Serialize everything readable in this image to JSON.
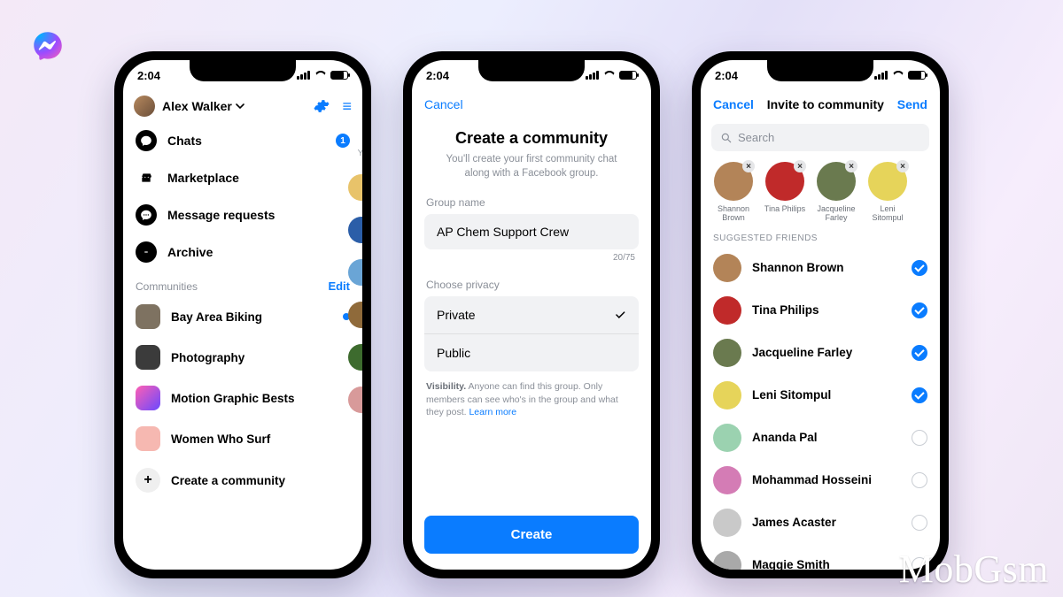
{
  "logo": {
    "color_start": "#FF6ABF",
    "color_mid": "#9C4BFF",
    "color_end": "#00AEFF"
  },
  "status": {
    "time": "2:04"
  },
  "phone1": {
    "user_name": "Alex Walker",
    "nav": [
      {
        "icon": "chat",
        "label": "Chats",
        "badge": "1"
      },
      {
        "icon": "store",
        "label": "Marketplace"
      },
      {
        "icon": "dots",
        "label": "Message requests"
      },
      {
        "icon": "archive",
        "label": "Archive"
      }
    ],
    "right_hint": "Yo",
    "communities_label": "Communities",
    "edit_label": "Edit",
    "communities": [
      {
        "label": "Bay Area Biking",
        "thumb": "#7e7261",
        "unread": true
      },
      {
        "label": "Photography",
        "thumb": "#3b3b3b"
      },
      {
        "label": "Motion Graphic Bests",
        "thumb": "linear-gradient(135deg,#ff5fb3,#6a49ff)"
      },
      {
        "label": "Women Who Surf",
        "thumb": "#f6b8b1"
      }
    ],
    "create_label": "Create a community"
  },
  "phone2": {
    "cancel": "Cancel",
    "title": "Create a community",
    "subtitle": "You'll create your first community chat along with a Facebook group.",
    "group_name_label": "Group name",
    "group_name_value": "AP Chem Support Crew",
    "counter": "20/75",
    "privacy_label": "Choose privacy",
    "privacy_options": [
      "Private",
      "Public"
    ],
    "privacy_selected": 0,
    "visibility_prefix": "Visibility.",
    "visibility_text": " Anyone can find this group. Only members can see who's in the group and what they post. ",
    "learn_more": "Learn more",
    "create_button": "Create"
  },
  "phone3": {
    "cancel": "Cancel",
    "title": "Invite to community",
    "send": "Send",
    "search_placeholder": "Search",
    "selected": [
      {
        "name": "Shannon Brown",
        "color": "#b38458"
      },
      {
        "name": "Tina Philips",
        "color": "#c02a2a"
      },
      {
        "name": "Jacqueline Farley",
        "color": "#6a7a4f"
      },
      {
        "name": "Leni Sitompul",
        "color": "#e6d45a"
      }
    ],
    "suggested_label": "SUGGESTED FRIENDS",
    "friends": [
      {
        "name": "Shannon Brown",
        "on": true,
        "color": "#b38458"
      },
      {
        "name": "Tina Philips",
        "on": true,
        "color": "#c02a2a"
      },
      {
        "name": "Jacqueline Farley",
        "on": true,
        "color": "#6a7a4f"
      },
      {
        "name": "Leni Sitompul",
        "on": true,
        "color": "#e6d45a"
      },
      {
        "name": "Ananda Pal",
        "on": false,
        "color": "#9bd2b0"
      },
      {
        "name": "Mohammad Hosseini",
        "on": false,
        "color": "#d47cb5"
      },
      {
        "name": "James Acaster",
        "on": false,
        "color": "#c9c9c9"
      },
      {
        "name": "Maggie Smith",
        "on": false,
        "color": "#a9a9a9"
      }
    ]
  },
  "watermark": "MobGsm"
}
